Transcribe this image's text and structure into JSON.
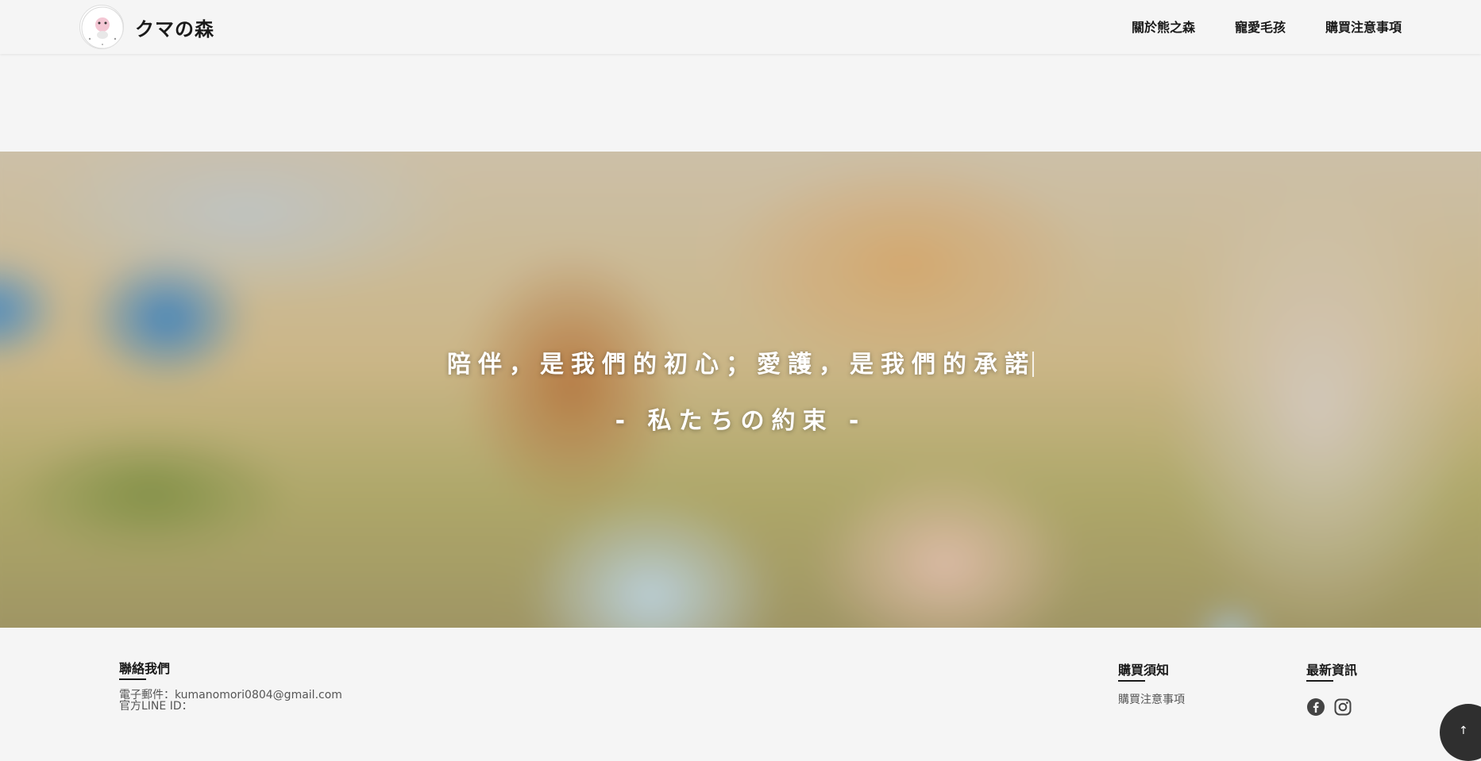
{
  "header": {
    "brand_name": "クマの森",
    "nav": [
      {
        "label": "關於熊之森"
      },
      {
        "label": "寵愛毛孩"
      },
      {
        "label": "購買注意事項"
      }
    ]
  },
  "hero": {
    "line1": "陪伴，是我們的初心；愛護，是我們的承諾",
    "line2": "- 私たちの約束 -"
  },
  "footer": {
    "contact": {
      "title": "聯絡我們",
      "email": "電子郵件：kumanomori0804@gmail.com",
      "line": "官方LINE ID："
    },
    "purchase": {
      "title": "購買須知",
      "link": "購買注意事項"
    },
    "news": {
      "title": "最新資訊",
      "icons": [
        "facebook-icon",
        "instagram-icon"
      ]
    }
  },
  "back_to_top": {
    "icon": "arrow-up-icon",
    "glyph": "↑"
  },
  "colors": {
    "background": "#f5f5f5",
    "text": "#1a1a1a",
    "muted": "#555555",
    "back_to_top": "#2f2f2f"
  }
}
